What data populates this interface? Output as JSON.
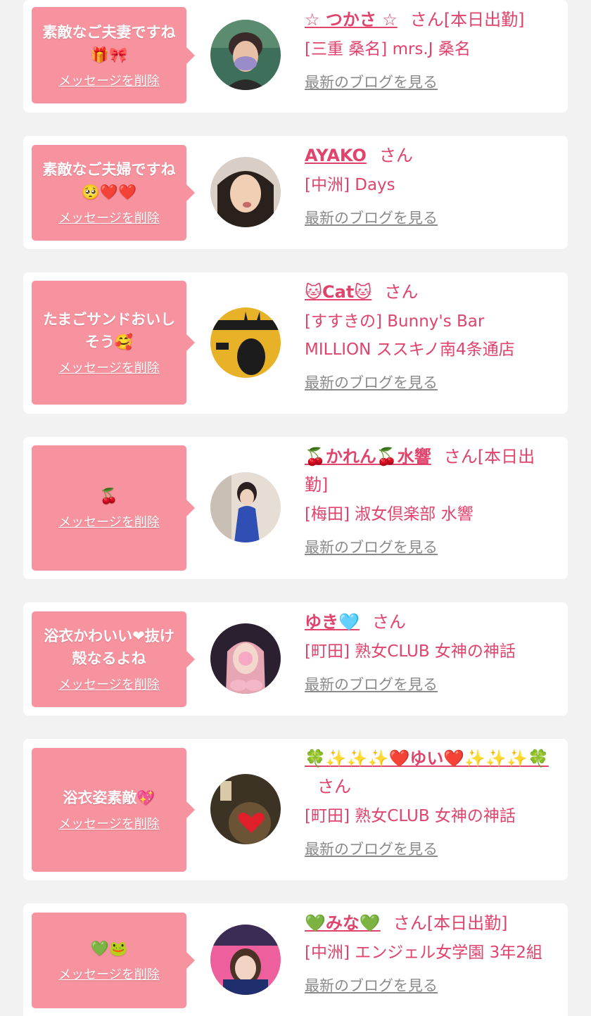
{
  "cards": [
    {
      "message": "素敵なご夫妻ですね🎁🎀",
      "delete_label": "メッセージを削除",
      "name": "☆ つかさ ☆",
      "suffix": "さん[本日出勤]",
      "shop": "[三重 桑名] mrs.J 桑名",
      "blog_label": "最新のブログを見る",
      "avatar_icon": "avatar-photo-woman-mask"
    },
    {
      "message": "素敵なご夫婦ですね🥺❤️❤️",
      "delete_label": "メッセージを削除",
      "name": "AYAKO",
      "suffix": "さん",
      "shop": "[中洲] Days",
      "blog_label": "最新のブログを見る",
      "avatar_icon": "avatar-photo-woman"
    },
    {
      "message": "たまごサンドおいしそう🥰",
      "delete_label": "メッセージを削除",
      "name": "🐱Cat🐱",
      "suffix": "さん",
      "shop": "[すすきの] Bunny's Bar MILLION ススキノ南4条通店",
      "blog_label": "最新のブログを見る",
      "avatar_icon": "avatar-photo-million-poster"
    },
    {
      "message": "🍒",
      "delete_label": "メッセージを削除",
      "name": "🍒かれん🍒水響",
      "suffix": "さん[本日出勤]",
      "shop": "[梅田] 淑女倶楽部 水響",
      "blog_label": "最新のブログを見る",
      "avatar_icon": "avatar-photo-woman-blue-dress"
    },
    {
      "message": "浴衣かわいい❤抜け殻なるよね",
      "delete_label": "メッセージを削除",
      "name": "ゆき🩵",
      "suffix": "さん",
      "shop": "[町田] 熟女CLUB 女神の神話",
      "blog_label": "最新のブログを見る",
      "avatar_icon": "avatar-photo-woman-pink-hair"
    },
    {
      "message": "浴衣姿素敵💖",
      "delete_label": "メッセージを削除",
      "name": "🍀✨✨✨❤️ゆい❤️✨✨✨🍀",
      "suffix": "さん",
      "shop": "[町田] 熟女CLUB 女神の神話",
      "blog_label": "最新のブログを見る",
      "avatar_icon": "avatar-photo-heart"
    },
    {
      "message": "💚🐸",
      "delete_label": "メッセージを削除",
      "name": "💚みな💚",
      "suffix": "さん[本日出勤]",
      "shop": "[中洲] エンジェル女学園 3年2組",
      "blog_label": "最新のブログを見る",
      "avatar_icon": "avatar-photo-school-girl"
    }
  ],
  "colors": {
    "background": "#f2f2f2",
    "card": "#ffffff",
    "bubble": "#f7939f",
    "accent": "#e0436b",
    "link_gray": "#8a8a8a"
  }
}
